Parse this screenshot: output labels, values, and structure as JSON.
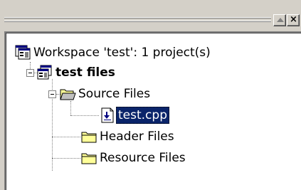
{
  "window": {
    "restore_icon": "restore-triangle-icon",
    "close_label": "×"
  },
  "tree": {
    "workspace": {
      "label": "Workspace 'test': 1 project(s)",
      "icon": "workspace-icon"
    },
    "project": {
      "label": "test files",
      "icon": "project-icon",
      "expanded": true
    },
    "folders": [
      {
        "label": "Source Files",
        "icon": "folder-open-icon",
        "expanded": true,
        "files": [
          {
            "label": "test.cpp",
            "icon": "cpp-file-icon",
            "selected": true
          }
        ]
      },
      {
        "label": "Header Files",
        "icon": "folder-closed-icon",
        "expanded": false
      },
      {
        "label": "Resource Files",
        "icon": "folder-closed-icon",
        "expanded": false
      }
    ]
  },
  "colors": {
    "selection_bg": "#0a246a",
    "selection_text": "#ffffff",
    "folder_yellow": "#ffff99",
    "face": "#d4d0c8"
  }
}
